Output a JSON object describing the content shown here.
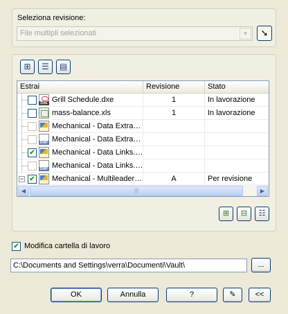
{
  "revision": {
    "label": "Seleziona revisione:",
    "combo_value": "File multipli selezionati"
  },
  "view_toolbar": {
    "icons": [
      "tree-view-icon",
      "list-view-icon",
      "hierarchy-view-icon"
    ]
  },
  "grid": {
    "columns": [
      "Estrai",
      "Revisione",
      "Stato"
    ],
    "rows": [
      {
        "name": "Grill Schedule.dxe",
        "revision": "1",
        "state": "In lavorazione",
        "checked": false,
        "enabled": true,
        "type": "dxe"
      },
      {
        "name": "mass-balance.xls",
        "revision": "1",
        "state": "In lavorazione",
        "checked": false,
        "enabled": true,
        "type": "xls"
      },
      {
        "name": "Mechanical - Data Extra…",
        "revision": "",
        "state": "",
        "checked": false,
        "enabled": false,
        "type": "dwg"
      },
      {
        "name": "Mechanical - Data Extra…",
        "revision": "",
        "state": "",
        "checked": false,
        "enabled": false,
        "type": "dwf"
      },
      {
        "name": "Mechanical - Data Links.…",
        "revision": "",
        "state": "",
        "checked": true,
        "enabled": true,
        "type": "dwg"
      },
      {
        "name": "Mechanical - Data Links.…",
        "revision": "",
        "state": "",
        "checked": false,
        "enabled": false,
        "type": "dwf"
      },
      {
        "name": "Mechanical - Multileader…",
        "revision": "A",
        "state": "Per revisione",
        "checked": true,
        "enabled": true,
        "type": "dwg"
      }
    ],
    "dwf_tag": "DWF",
    "dxe_tag": "DXE"
  },
  "modify": {
    "label": "Modifica cartella di lavoro",
    "checked": true,
    "path": "C:\\Documents and Settings\\verra\\Documenti\\Vault\\",
    "browse_label": "..."
  },
  "buttons": {
    "ok": "OK",
    "cancel": "Annulla",
    "help": "?",
    "collapse": "<<"
  }
}
